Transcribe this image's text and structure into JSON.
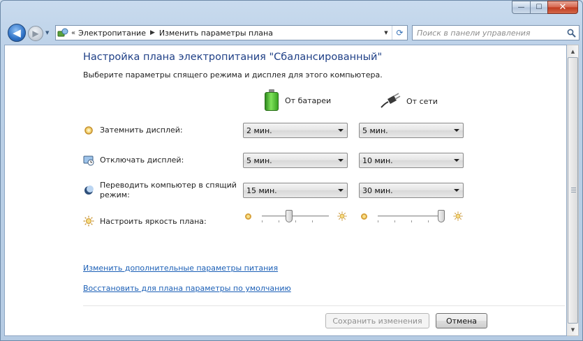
{
  "window": {
    "minimize": "—",
    "maximize": "☐",
    "close": "✕"
  },
  "nav": {
    "back": "◀",
    "forward": "▶",
    "breadcrumbs": [
      "Электропитание",
      "Изменить параметры плана"
    ],
    "search_placeholder": "Поиск в панели управления"
  },
  "page": {
    "title": "Настройка плана электропитания \"Сбалансированный\"",
    "subtitle": "Выберите параметры спящего режима и дисплея для этого компьютера."
  },
  "columns": {
    "battery": "От батареи",
    "plugged": "От сети"
  },
  "settings": [
    {
      "label": "Затемнить дисплей:",
      "battery": "2 мин.",
      "plugged": "5 мин."
    },
    {
      "label": "Отключать дисплей:",
      "battery": "5 мин.",
      "plugged": "10 мин."
    },
    {
      "label_line1": "Переводить компьютер в спящий",
      "label_line2": "режим:",
      "battery": "15 мин.",
      "plugged": "30 мин."
    }
  ],
  "brightness": {
    "label": "Настроить яркость плана:",
    "battery_level_percent": 40,
    "plugged_level_percent": 100
  },
  "links": {
    "advanced": "Изменить дополнительные параметры питания",
    "restore": "Восстановить для плана параметры по умолчанию"
  },
  "buttons": {
    "save": "Сохранить изменения",
    "cancel": "Отмена"
  },
  "colors": {
    "title": "#1e3f86",
    "link": "#1b5fb6",
    "close_button": "#c0391e"
  }
}
